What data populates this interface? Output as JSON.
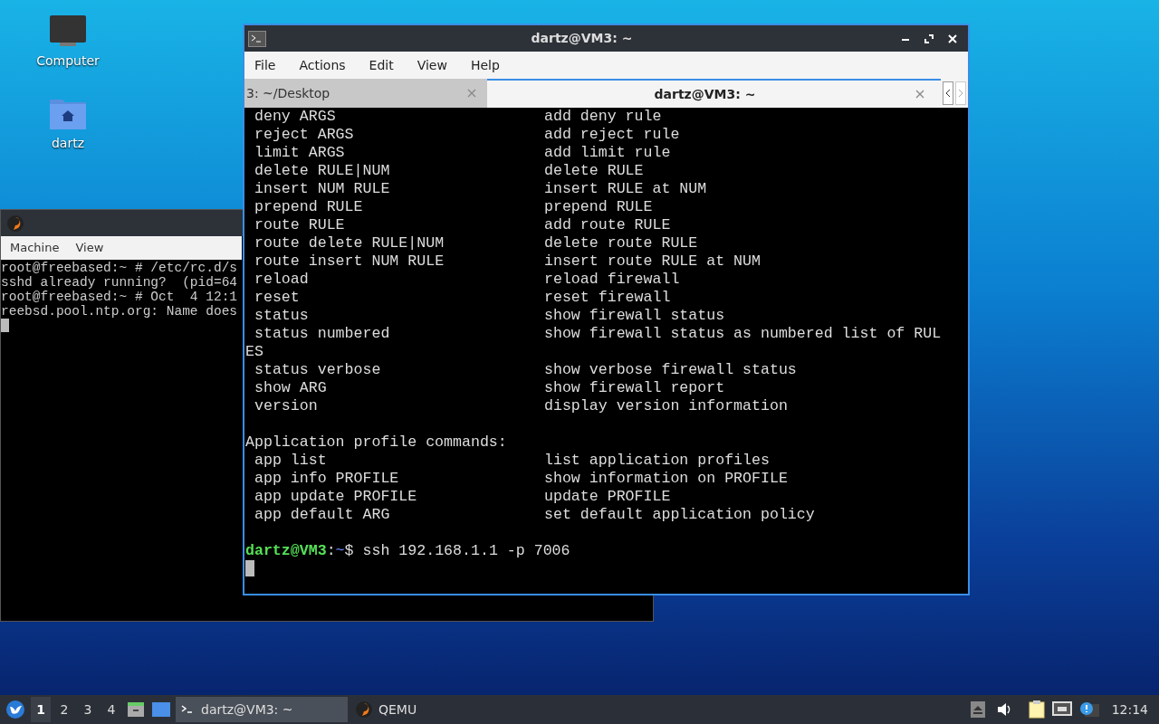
{
  "desktop_icons": [
    {
      "kind": "computer",
      "label": "Computer"
    },
    {
      "kind": "home",
      "label": "dartz"
    }
  ],
  "qemu_window": {
    "menu": [
      "Machine",
      "View"
    ],
    "console_lines": [
      "root@freebased:~ # /etc/rc.d/s",
      "sshd already running?  (pid=64",
      "root@freebased:~ # Oct  4 12:1",
      "reebsd.pool.ntp.org: Name does"
    ]
  },
  "terminal": {
    "title": "dartz@VM3: ~",
    "menu": [
      "File",
      "Actions",
      "Edit",
      "View",
      "Help"
    ],
    "tabs": [
      {
        "label": "3: ~/Desktop",
        "selected": false
      },
      {
        "label": "dartz@VM3: ~",
        "selected": true
      }
    ],
    "lines": [
      {
        "kind": "pair",
        "command": "deny ARGS",
        "description": "add deny rule"
      },
      {
        "kind": "pair",
        "command": "reject ARGS",
        "description": "add reject rule"
      },
      {
        "kind": "pair",
        "command": "limit ARGS",
        "description": "add limit rule"
      },
      {
        "kind": "pair",
        "command": "delete RULE|NUM",
        "description": "delete RULE"
      },
      {
        "kind": "pair",
        "command": "insert NUM RULE",
        "description": "insert RULE at NUM"
      },
      {
        "kind": "pair",
        "command": "prepend RULE",
        "description": "prepend RULE"
      },
      {
        "kind": "pair",
        "command": "route RULE",
        "description": "add route RULE"
      },
      {
        "kind": "pair",
        "command": "route delete RULE|NUM",
        "description": "delete route RULE"
      },
      {
        "kind": "pair",
        "command": "route insert NUM RULE",
        "description": "insert route RULE at NUM"
      },
      {
        "kind": "pair",
        "command": "reload",
        "description": "reload firewall"
      },
      {
        "kind": "pair",
        "command": "reset",
        "description": "reset firewall"
      },
      {
        "kind": "pair",
        "command": "status",
        "description": "show firewall status"
      },
      {
        "kind": "pair",
        "command": "status numbered",
        "description": "show firewall status as numbered list of RUL"
      },
      {
        "kind": "text",
        "text": "ES"
      },
      {
        "kind": "pair",
        "command": "status verbose",
        "description": "show verbose firewall status"
      },
      {
        "kind": "pair",
        "command": "show ARG",
        "description": "show firewall report"
      },
      {
        "kind": "pair",
        "command": "version",
        "description": "display version information"
      },
      {
        "kind": "blank"
      },
      {
        "kind": "text",
        "text": "Application profile commands:"
      },
      {
        "kind": "pair",
        "command": "app list",
        "description": "list application profiles"
      },
      {
        "kind": "pair",
        "command": "app info PROFILE",
        "description": "show information on PROFILE"
      },
      {
        "kind": "pair",
        "command": "app update PROFILE",
        "description": "update PROFILE"
      },
      {
        "kind": "pair",
        "command": "app default ARG",
        "description": "set default application policy"
      },
      {
        "kind": "blank"
      },
      {
        "kind": "prompt",
        "user_host": "dartz@VM3",
        "separator": ":",
        "path": "~",
        "command": "$ ssh 192.168.1.1 -p 7006"
      },
      {
        "kind": "cursor"
      }
    ]
  },
  "taskbar": {
    "workspaces": [
      {
        "label": "1",
        "selected": true
      },
      {
        "label": "2",
        "selected": false
      },
      {
        "label": "3",
        "selected": false
      },
      {
        "label": "4",
        "selected": false
      }
    ],
    "tasks": [
      {
        "kind": "terminal",
        "label": "dartz@VM3: ~",
        "selected": true
      },
      {
        "kind": "qemu",
        "label": "QEMU",
        "selected": false
      }
    ],
    "clock": "12:14"
  }
}
